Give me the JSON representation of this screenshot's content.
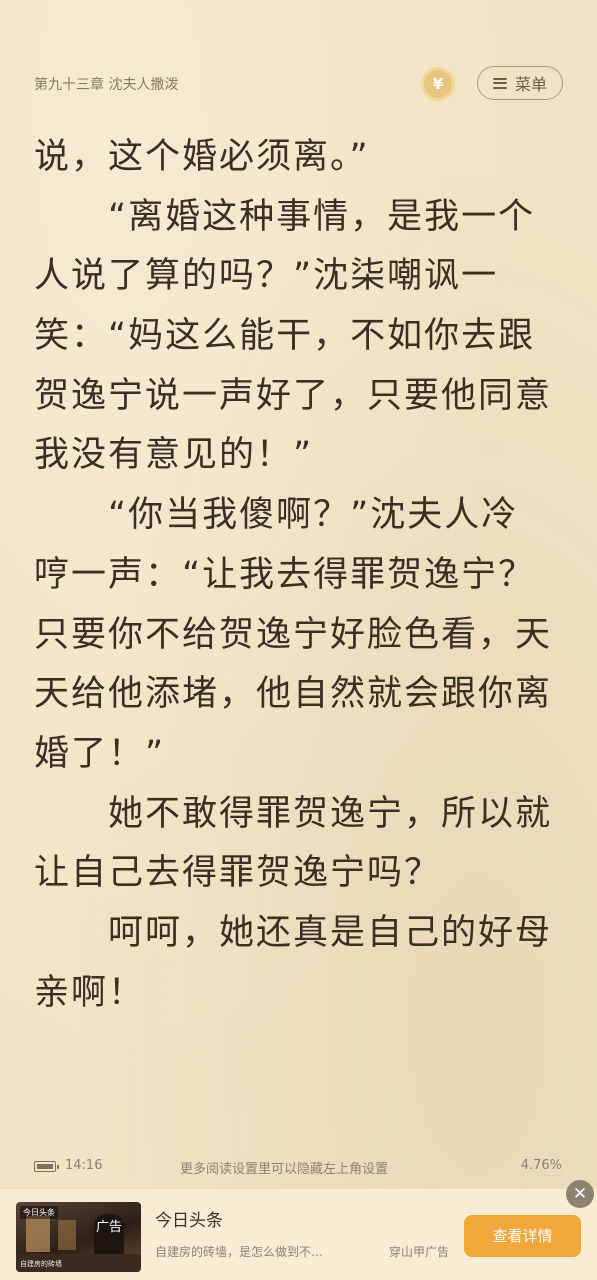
{
  "header": {
    "chapter_title": "第九十三章 沈夫人撒泼",
    "coin_glyph": "¥",
    "menu_label": "菜单"
  },
  "content": {
    "lines": [
      {
        "text": "说，这个婚必须离。”",
        "indent": false
      },
      {
        "text": "“离婚这种事情，是我一个",
        "indent": true
      },
      {
        "text": "人说了算的吗？”沈柒嘲讽一",
        "indent": false
      },
      {
        "text": "笑：“妈这么能干，不如你去跟",
        "indent": false
      },
      {
        "text": "贺逸宁说一声好了，只要他同意",
        "indent": false
      },
      {
        "text": "我没有意见的！”",
        "indent": false
      },
      {
        "text": "“你当我傻啊？”沈夫人冷",
        "indent": true
      },
      {
        "text": "哼一声：“让我去得罪贺逸宁？",
        "indent": false
      },
      {
        "text": "只要你不给贺逸宁好脸色看，天",
        "indent": false
      },
      {
        "text": "天给他添堵，他自然就会跟你离",
        "indent": false
      },
      {
        "text": "婚了！”",
        "indent": false
      },
      {
        "text": "她不敢得罪贺逸宁，所以就",
        "indent": true
      },
      {
        "text": "让自己去得罪贺逸宁吗？",
        "indent": false
      },
      {
        "text": "呵呵，她还真是自己的好母",
        "indent": true
      },
      {
        "text": "亲啊！",
        "indent": false
      }
    ]
  },
  "status": {
    "time": "14:16",
    "tip": "更多阅读设置里可以隐藏左上角设置",
    "progress": "4.76%",
    "battery_level": 0.8
  },
  "ad": {
    "label": "广告",
    "source": "今日头条",
    "description": "自建房的砖墙，是怎么做到不…",
    "tag": "穿山甲广告",
    "cta": "查看详情",
    "close_glyph": "✕",
    "thumb_badge": "今日头条",
    "thumb_caption": "自建房的砖墙"
  },
  "colors": {
    "page_background": "#f3e3c4",
    "text": "#3b2e22",
    "cta": "#f2a73a",
    "coin": "#e9c680"
  }
}
